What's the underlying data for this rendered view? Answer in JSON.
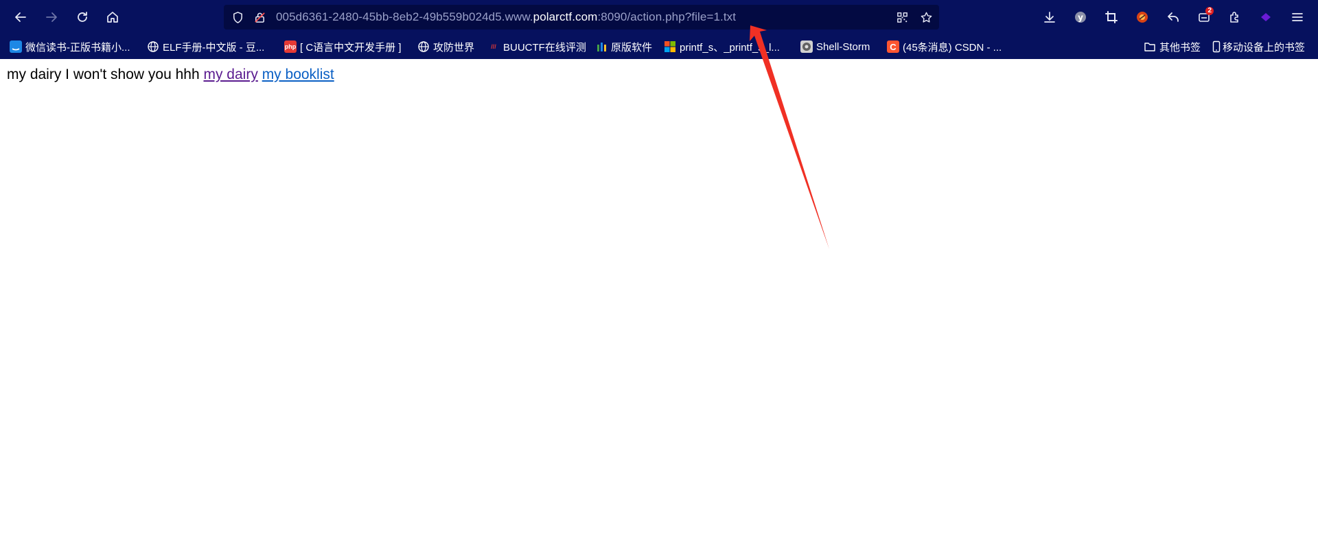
{
  "address_bar": {
    "url_prefix": "005d6361-2480-45bb-8eb2-49b559b024d5.www.",
    "url_host": "polarctf.com",
    "url_suffix": ":8090/action.php?file=1.txt"
  },
  "toolbar": {
    "extension_badge_count": "2"
  },
  "bookmarks": [
    {
      "label": "微信读书-正版书籍小...",
      "icon": "weread-icon",
      "color": "#1e88e5"
    },
    {
      "label": "ELF手册-中文版 - 豆...",
      "icon": "globe-icon",
      "color": "#ffffff"
    },
    {
      "label": "[ C语言中文开发手册 ]",
      "icon": "php-icon",
      "color": "#e53935"
    },
    {
      "label": "攻防世界",
      "icon": "globe-icon",
      "color": "#ffffff"
    },
    {
      "label": "BUUCTF在线评测",
      "icon": "buuctf-icon",
      "color": "#c62828"
    },
    {
      "label": "原版软件",
      "icon": "itellyou-icon",
      "color": "#43a047"
    },
    {
      "label": "printf_s、_printf_s_l...",
      "icon": "microsoft-icon",
      "color": "#f25022"
    },
    {
      "label": "Shell-Storm",
      "icon": "shellstorm-icon",
      "color": "#9e9e9e"
    },
    {
      "label": "(45条消息) CSDN - ...",
      "icon": "csdn-icon",
      "color": "#fc5531"
    }
  ],
  "other_bookmarks": "其他书签",
  "mobile_bookmarks": "移动设备上的书签",
  "page": {
    "text": "my dairy I won't show you hhh",
    "link1": "my dairy",
    "link2": "my booklist"
  },
  "colors": {
    "chrome_bg": "#06115e",
    "urlbar_bg": "#030a42",
    "annotation_arrow": "#f03024"
  }
}
